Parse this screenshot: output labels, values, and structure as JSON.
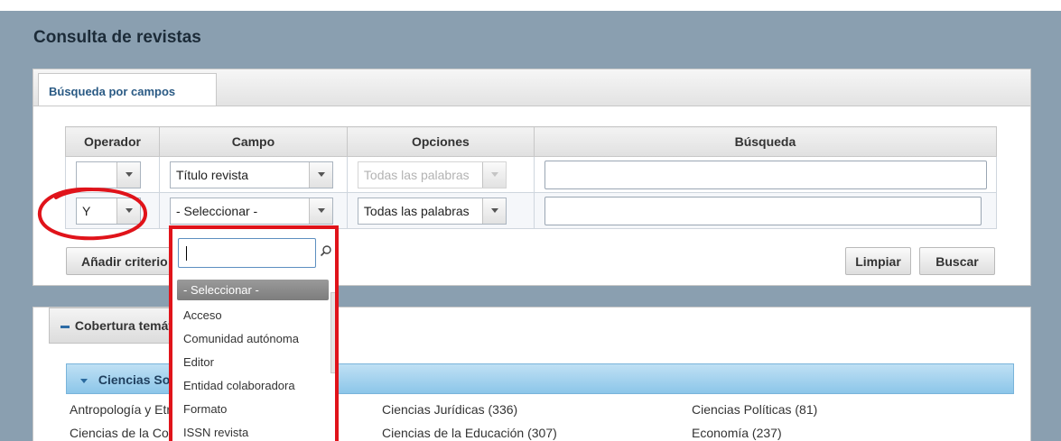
{
  "page": {
    "title": "Consulta de revistas"
  },
  "search_panel": {
    "tab_label": "Búsqueda por campos",
    "columns": [
      "Operador",
      "Campo",
      "Opciones",
      "Búsqueda"
    ],
    "rows": [
      {
        "operator": "",
        "field": "Título revista",
        "options": "Todas las palabras",
        "options_disabled": true,
        "query": ""
      },
      {
        "operator": "Y",
        "field": "- Seleccionar -",
        "options": "Todas las palabras",
        "options_disabled": false,
        "query": ""
      }
    ],
    "add_criteria_label": "Añadir criterio",
    "clear_label": "Limpiar",
    "search_label": "Buscar"
  },
  "coverage": {
    "header_label": "Cobertura temática",
    "category_label": "Ciencias Sociales",
    "items": [
      [
        "Antropología y Etnología (59)",
        "Ciencias Jurídicas (336)",
        "Ciencias Políticas (81)"
      ],
      [
        "Ciencias de la Comunicación (98)",
        "Ciencias de la Educación (307)",
        "Economía (237)"
      ]
    ]
  },
  "field_dropdown": {
    "search_value": "",
    "options": [
      "- Seleccionar -",
      "Acceso",
      "Comunidad autónoma",
      "Editor",
      "Entidad colaboradora",
      "Formato",
      "ISSN revista"
    ],
    "selected_index": 0
  },
  "icons": {
    "search": "search-icon",
    "dropdown_arrow": "chevron-down-icon"
  },
  "colors": {
    "annotation_red": "#e0131a",
    "accent_blue": "#2d6ba5",
    "backdrop": "#8a9fb0"
  }
}
